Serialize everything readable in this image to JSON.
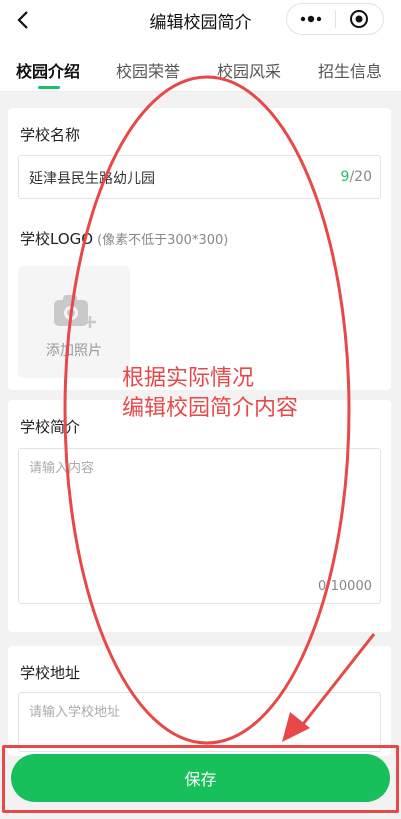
{
  "header": {
    "title": "编辑校园简介",
    "back_icon": "chevron-left-icon",
    "more_icon": "more-dots-icon",
    "close_icon": "target-circle-icon"
  },
  "tabs": [
    {
      "label": "校园介绍",
      "active": true
    },
    {
      "label": "校园荣誉",
      "active": false
    },
    {
      "label": "校园风采",
      "active": false
    },
    {
      "label": "招生信息",
      "active": false
    }
  ],
  "form": {
    "school_name": {
      "label": "学校名称",
      "value": "延津县民生路幼儿园",
      "count": "9",
      "max": "/20"
    },
    "logo": {
      "label": "学校LOGO",
      "hint": "(像素不低于300*300)",
      "upload_label": "添加照片",
      "icon": "camera-add-icon"
    },
    "intro": {
      "label": "学校简介",
      "placeholder": "请输入内容",
      "counter": "0/10000"
    },
    "address": {
      "label": "学校地址",
      "placeholder": "请输入学校地址"
    }
  },
  "annotation": {
    "line1": "根据实际情况",
    "line2": "编辑校园简介内容",
    "color": "#e84848"
  },
  "save_button": {
    "label": "保存",
    "color": "#17c05a"
  },
  "colors": {
    "accent": "#1ec06a",
    "annotation": "#e84848"
  }
}
